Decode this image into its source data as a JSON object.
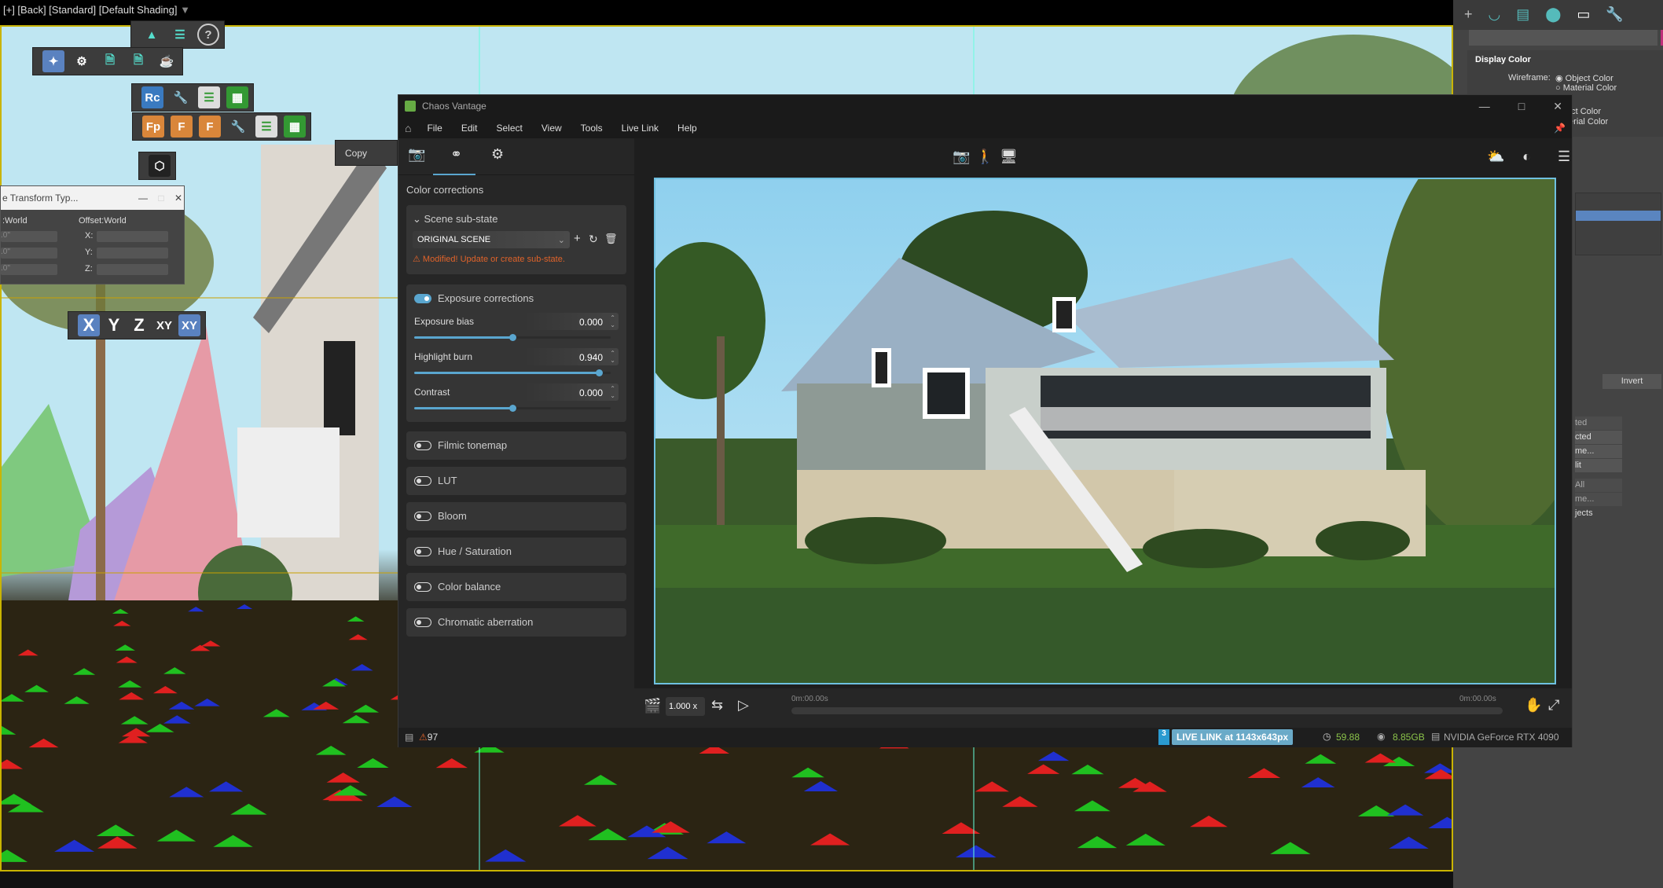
{
  "viewport": {
    "header": "[+] [Back] [Standard] [Default Shading]",
    "copy_label": "Copy",
    "axis_buttons": [
      "X",
      "Y",
      "Z",
      "XY",
      "XY"
    ],
    "toolbar_rc": "Rc",
    "toolbar_fp": "Fp",
    "toolbar_flod": "F",
    "toolbar_fset": "F"
  },
  "transform_dialog": {
    "title": "e Transform Typ...",
    "left_header": ":World",
    "right_header": "Offset:World",
    "left_values": [
      ".0\"",
      ".0\"",
      ".0\""
    ],
    "axes": [
      "X:",
      "Y:",
      "Z:"
    ]
  },
  "command_panel": {
    "section": "Display Color",
    "wireframe_label": "Wireframe:",
    "options": [
      "Object Color",
      "Material Color",
      "ect Color",
      "terial Color"
    ],
    "invert": "Invert",
    "partial_buttons": [
      "ted",
      "cted",
      "me...",
      "lit",
      "All",
      "me...",
      "jects"
    ]
  },
  "vantage": {
    "title": "Chaos Vantage",
    "menu": [
      "File",
      "Edit",
      "Select",
      "View",
      "Tools",
      "Live Link",
      "Help"
    ],
    "panel_title": "Color corrections",
    "scene_substate": {
      "header": "Scene sub-state",
      "selected": "ORIGINAL SCENE",
      "warning": "Modified! Update or create sub-state."
    },
    "exposure": {
      "label": "Exposure corrections",
      "enabled": true,
      "sliders": [
        {
          "label": "Exposure bias",
          "value": "0.000",
          "fraction": 0.5
        },
        {
          "label": "Highlight burn",
          "value": "0.940",
          "fraction": 0.94
        },
        {
          "label": "Contrast",
          "value": "0.000",
          "fraction": 0.5
        }
      ]
    },
    "effects": [
      {
        "label": "Filmic tonemap",
        "enabled": false
      },
      {
        "label": "LUT",
        "enabled": false
      },
      {
        "label": "Bloom",
        "enabled": false
      },
      {
        "label": "Hue / Saturation",
        "enabled": false
      },
      {
        "label": "Color balance",
        "enabled": false
      },
      {
        "label": "Chromatic aberration",
        "enabled": false
      }
    ],
    "timeline": {
      "speed": "1.000 x",
      "start": "0m:00.00s",
      "end": "0m:00.00s"
    },
    "status": {
      "warnings": "97",
      "max_badge": "3",
      "live_link": "LIVE LINK at 1143x643px",
      "fps": "59.88",
      "vram": "8.85GB",
      "gpu": "NVIDIA GeForce RTX 4090"
    },
    "colors": {
      "accent": "#5aa6cf",
      "warning": "#e0632a",
      "ok_green": "#8bc34a"
    }
  }
}
